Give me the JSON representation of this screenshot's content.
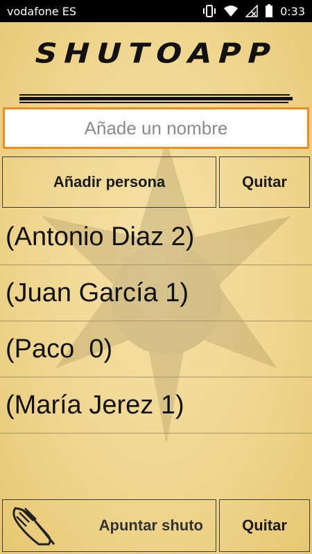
{
  "status_bar": {
    "carrier": "vodafone ES",
    "time": "0:33",
    "icons": [
      "vibrate-icon",
      "wifi-icon",
      "no-signal-icon",
      "battery-icon"
    ]
  },
  "app": {
    "logo": "SHUTOAPP",
    "name_input": {
      "placeholder": "Añade un nombre",
      "value": ""
    },
    "add_button": "Añadir persona",
    "remove_button_top": "Quitar",
    "people": [
      "(Antonio Diaz 2)",
      "(Juan García 1)",
      "(Paco  0)",
      "(María Jerez 1)"
    ],
    "shuto_button": "Apuntar shuto",
    "remove_button_bottom": "Quitar"
  },
  "colors": {
    "background": "#f3dc9a",
    "input_border": "#f08c1e",
    "button_border": "#3a3a3a",
    "status_bar": "#000000"
  }
}
